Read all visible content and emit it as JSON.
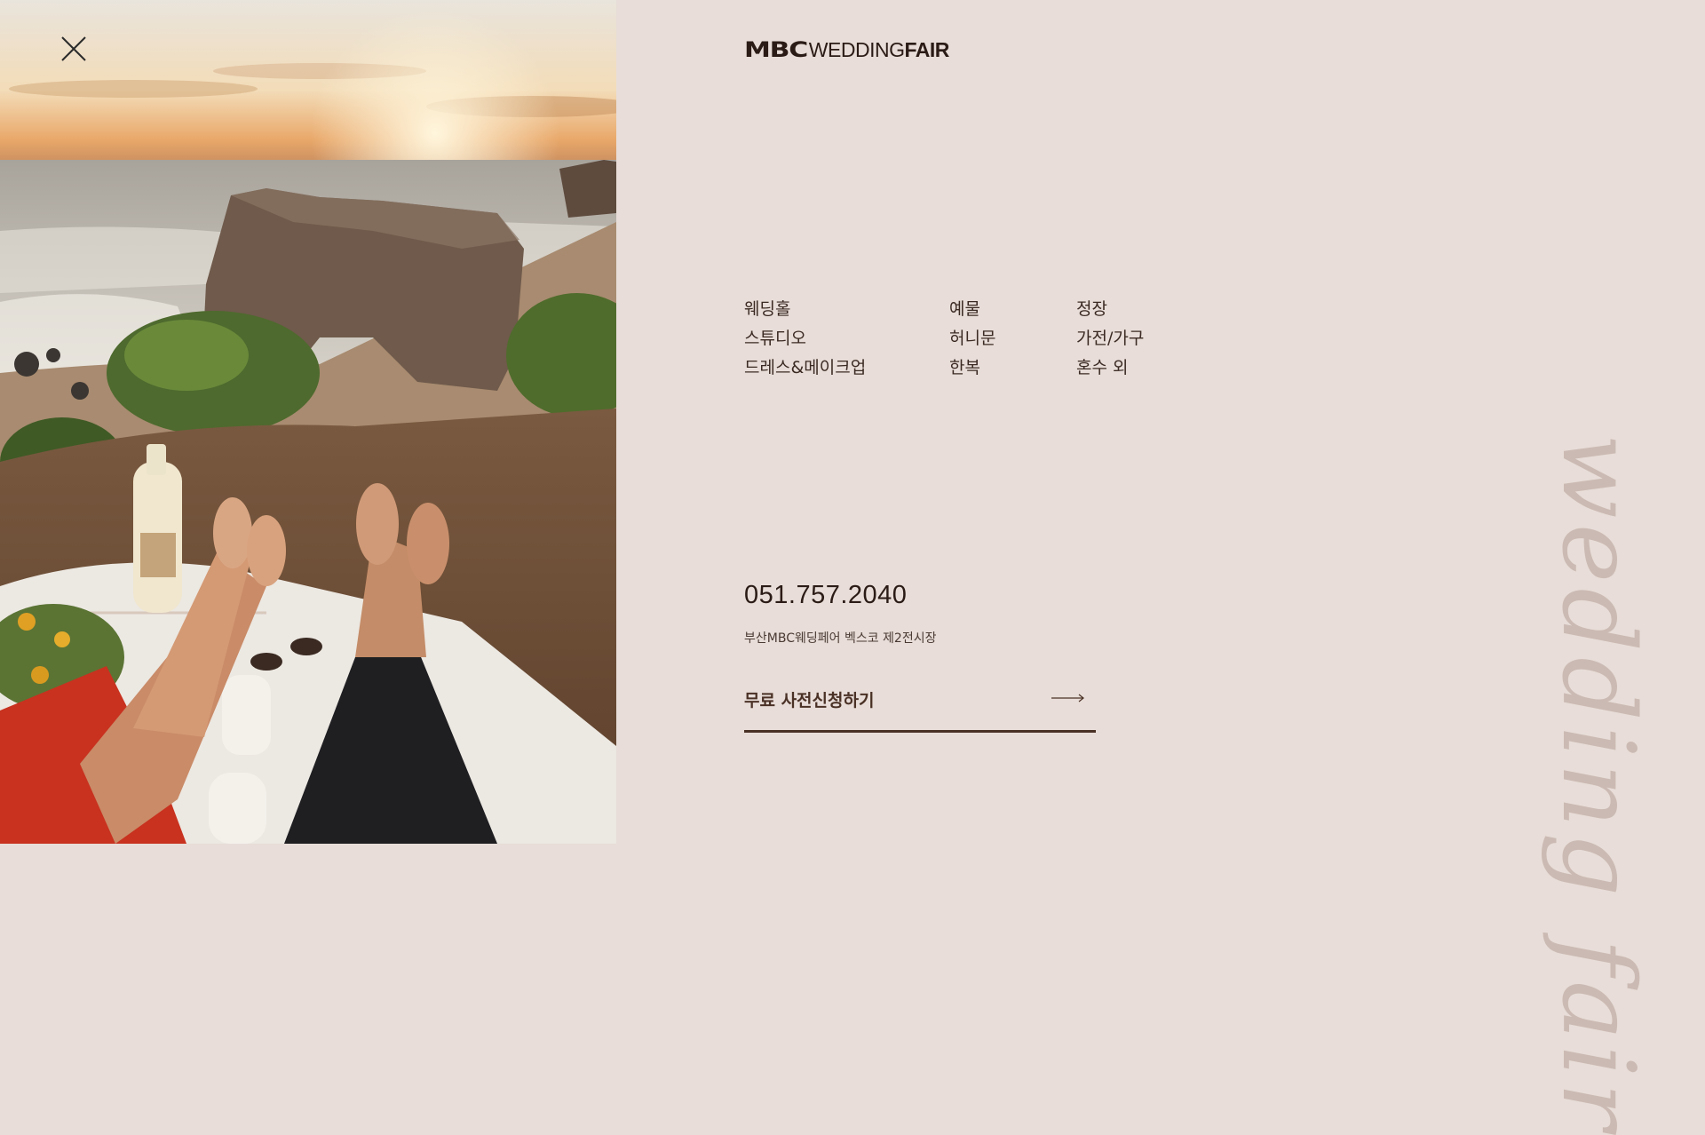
{
  "header": {
    "logo_mark": "MBC",
    "logo_wedding": "WEDDING",
    "logo_fair": "FAIR"
  },
  "photo": {
    "description_icon": "beach-picnic-photo"
  },
  "menu": {
    "col1": [
      "웨딩홀",
      "스튜디오",
      "드레스&메이크업"
    ],
    "col2": [
      "예물",
      "허니문",
      "한복"
    ],
    "col3": [
      "정장",
      "가전/가구",
      "혼수 외"
    ]
  },
  "contact": {
    "phone": "051.757.2040",
    "address": "부산MBC웨딩페어 벡스코 제2전시장"
  },
  "cta": {
    "label": "무료 사전신청하기",
    "arrow_icon": "long-arrow-right-icon"
  },
  "decor": {
    "script": "wedding fair"
  },
  "colors": {
    "background": "#e8ddd8",
    "text": "#3b2a24",
    "accent": "#4a3126"
  }
}
